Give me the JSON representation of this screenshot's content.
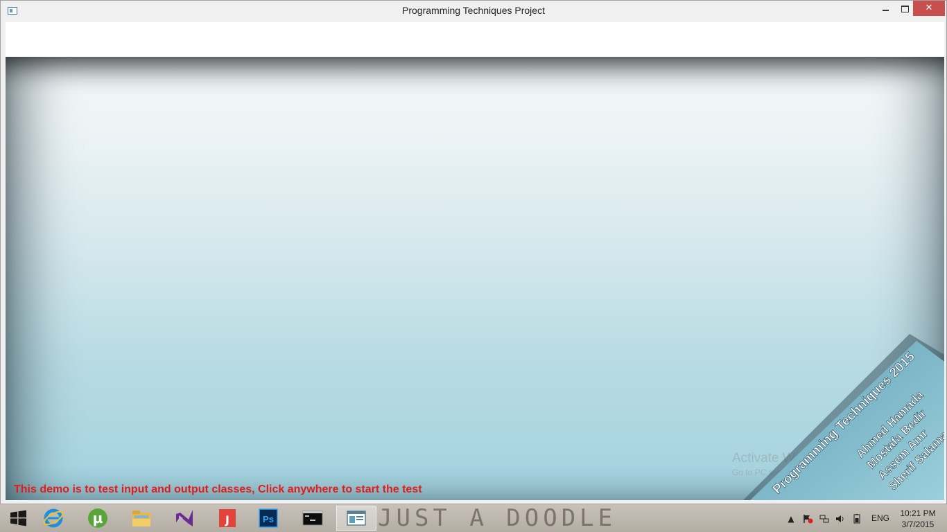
{
  "window": {
    "title": "Programming Techniques Project",
    "close_glyph": "✕"
  },
  "canvas": {
    "hint_text": "This demo is to test input and output classes, Click anywhere to start the test",
    "hint_color": "#e41b1b",
    "banner_title": "Programming Techniques 2015",
    "banner_names": [
      "Ahmed Hamada",
      "Mostafa Bedir",
      "Assem Amr",
      "Sherif Salama"
    ],
    "watermark_line1": "Activate Windows",
    "watermark_line2": "Go to PC settings to activate Windows."
  },
  "taskbar": {
    "doodle_text": "JUST A DOODLE",
    "apps": [
      {
        "name": "internet-explorer-icon",
        "active": false
      },
      {
        "name": "utorrent-icon",
        "active": false
      },
      {
        "name": "file-explorer-icon",
        "active": false
      },
      {
        "name": "visual-studio-icon",
        "active": false
      },
      {
        "name": "acrobat-icon",
        "active": false
      },
      {
        "name": "photoshop-icon",
        "active": false
      },
      {
        "name": "command-prompt-icon",
        "active": false
      },
      {
        "name": "project-window-icon",
        "active": true
      }
    ],
    "language": "ENG",
    "time": "10:21 PM",
    "date": "3/7/2015"
  }
}
